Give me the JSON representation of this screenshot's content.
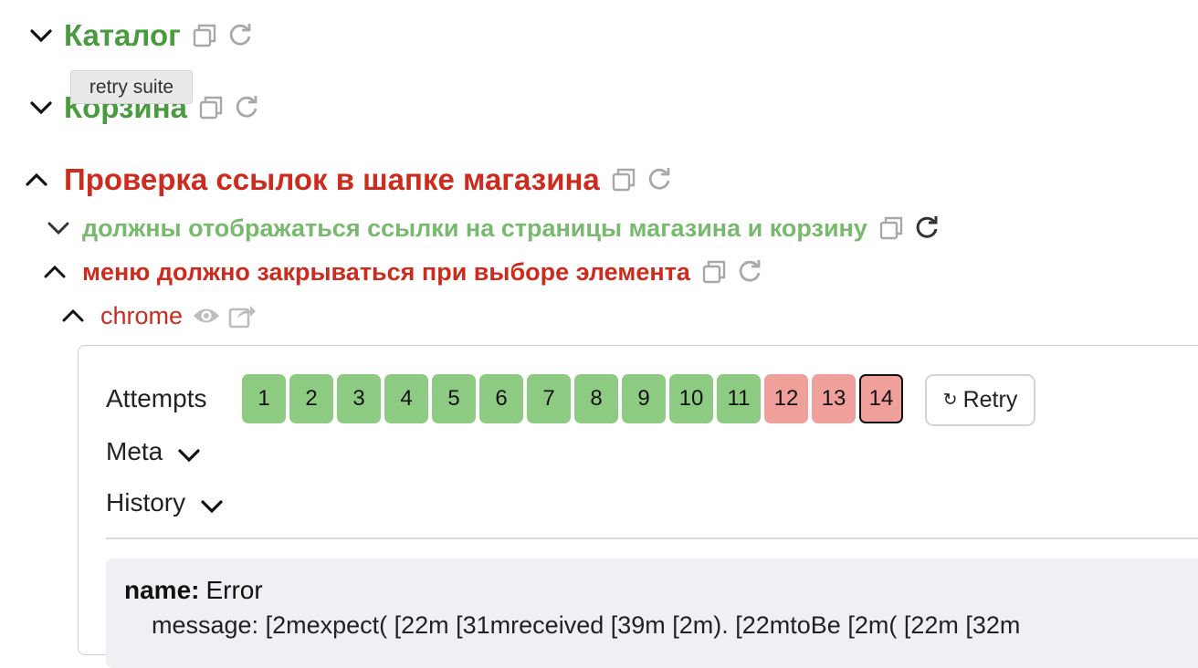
{
  "tooltip": "retry suite",
  "suites": [
    {
      "title": "Каталог",
      "state": "collapsed",
      "status": "passed"
    },
    {
      "title": "Корзина",
      "state": "collapsed",
      "status": "passed"
    },
    {
      "title": "Проверка ссылок в шапке магазина",
      "state": "expanded",
      "status": "failed"
    }
  ],
  "tests": [
    {
      "title": "должны отображаться ссылки на страницы магазина и корзину",
      "state": "collapsed",
      "status": "passed"
    },
    {
      "title": "меню должно закрываться при выборе элемента",
      "state": "expanded",
      "status": "failed"
    }
  ],
  "browser": {
    "name": "chrome",
    "state": "expanded"
  },
  "details": {
    "attempts_label": "Attempts",
    "attempts": [
      {
        "label": "1",
        "status": "passed"
      },
      {
        "label": "2",
        "status": "passed"
      },
      {
        "label": "3",
        "status": "passed"
      },
      {
        "label": "4",
        "status": "passed"
      },
      {
        "label": "5",
        "status": "passed"
      },
      {
        "label": "6",
        "status": "passed"
      },
      {
        "label": "7",
        "status": "passed"
      },
      {
        "label": "8",
        "status": "passed"
      },
      {
        "label": "9",
        "status": "passed"
      },
      {
        "label": "10",
        "status": "passed"
      },
      {
        "label": "11",
        "status": "passed"
      },
      {
        "label": "12",
        "status": "failed"
      },
      {
        "label": "13",
        "status": "failed"
      },
      {
        "label": "14",
        "status": "failed",
        "current": true
      }
    ],
    "retry_icon": "↻",
    "retry_label": "Retry",
    "meta_label": "Meta",
    "history_label": "History"
  },
  "error": {
    "name_key": "name:",
    "name_value": "Error",
    "message_line": "    message: [2mexpect( [22m [31mreceived [39m [2m). [22mtoBe [2m( [22m [32m"
  },
  "colors": {
    "passed_title": "#4a9a40",
    "passed_test": "#77ba6d",
    "failed": "#cc2b1d",
    "attempt_passed": "#8ecb82",
    "attempt_failed": "#f0a09b"
  }
}
